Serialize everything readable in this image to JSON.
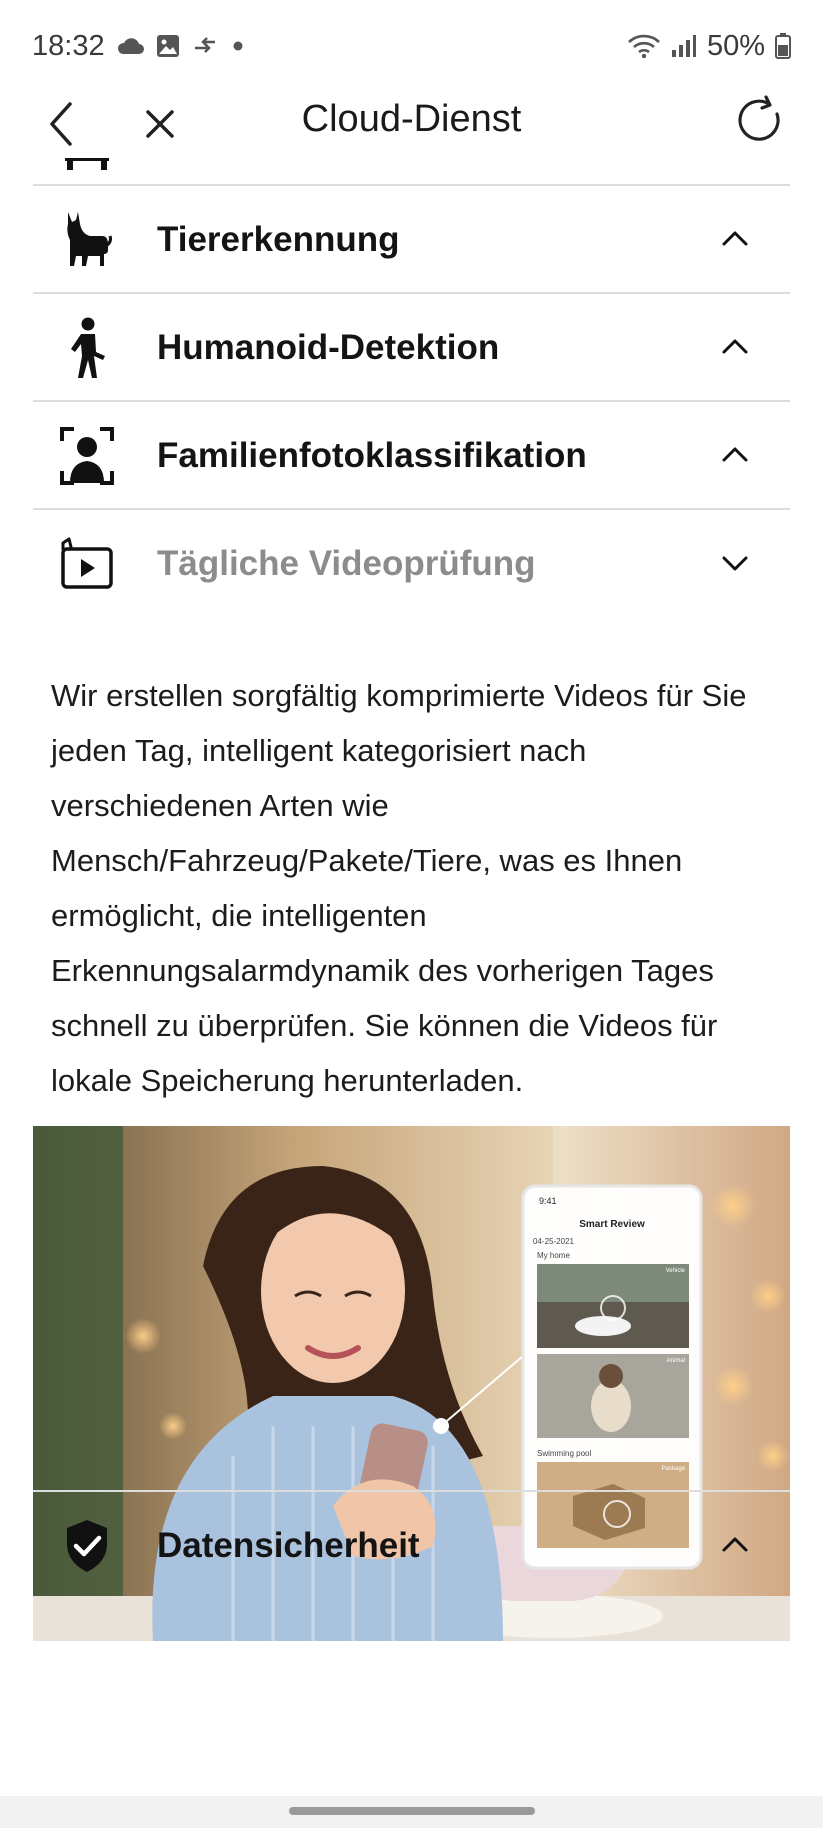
{
  "status_bar": {
    "time": "18:32",
    "battery": "50%",
    "left_icons": [
      "cloud-icon",
      "image-icon",
      "transfer-icon",
      "dot-icon"
    ],
    "right_icons": [
      "wifi-icon",
      "signal-icon",
      "battery-icon"
    ]
  },
  "header": {
    "title": "Cloud-Dienst",
    "back_icon": "chevron-left-icon",
    "close_icon": "close-icon",
    "refresh_icon": "refresh-icon"
  },
  "sections": [
    {
      "label": "Tiererkennung",
      "icon": "cat-icon",
      "expanded": false
    },
    {
      "label": "Humanoid-Detektion",
      "icon": "person-walking-icon",
      "expanded": false
    },
    {
      "label": "Familienfotoklassifikation",
      "icon": "face-scan-icon",
      "expanded": false
    },
    {
      "label": "Tägliche Videoprüfung",
      "icon": "video-play-icon",
      "expanded": true
    },
    {
      "label": "Datensicherheit",
      "icon": "shield-check-icon",
      "expanded": false
    }
  ],
  "expanded_section": {
    "description": "Wir erstellen sorgfältig komprimierte Videos für Sie jeden Tag, intelligent kategorisiert nach verschiedenen Arten wie Mensch/Fahrzeug/Pakete/Tiere, was es Ihnen ermöglicht, die intelligenten Erkennungsalarmdynamik des vorherigen Tages schnell zu überprüfen. Sie können die Videos für lokale Speicherung herunterladen.",
    "illustration": {
      "phone_time": "9:41",
      "phone_title": "Smart Review",
      "phone_date": "04-25-2021",
      "group_1": "My home",
      "tag_1": "Vehicle",
      "tag_2": "Animal",
      "group_2": "Swimming pool",
      "tag_3": "Package"
    }
  },
  "colors": {
    "text": "#141414",
    "muted_text": "#8c8c8c",
    "divider": "#dddddd",
    "background": "#ffffff"
  }
}
